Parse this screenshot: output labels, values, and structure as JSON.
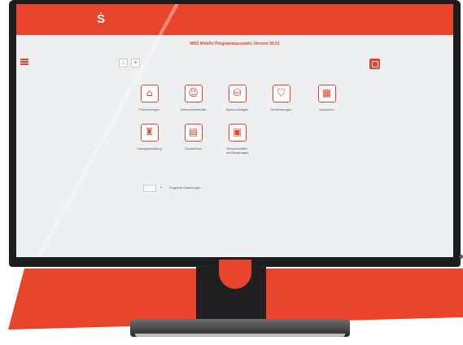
{
  "app": {
    "title": "MRZ-WebRx Programmauswahl, Version 00.01",
    "logo": "Ṡ",
    "brand_color": "#e8442b",
    "background_color": "#eeeff1"
  },
  "toolbar": {
    "menu_icon": "hamburger-icon",
    "home_icon": "home-icon",
    "list_icon": "list-icon",
    "home_glyph": "⌂",
    "list_glyph": "≡",
    "exit_icon": "exit-icon"
  },
  "tiles": [
    {
      "id": "finanzierungen",
      "label": "Finanzierungen",
      "icon": "house-icon",
      "glyph": "⌂"
    },
    {
      "id": "verbraucherkredite",
      "label": "Verbraucherkredite",
      "icon": "person-money-icon",
      "glyph": "☺"
    },
    {
      "id": "sparen-anlagen",
      "label": "Sparen-Anlagen",
      "icon": "coins-icon",
      "glyph": "⛁"
    },
    {
      "id": "versicherungen",
      "label": "Versicherungen",
      "icon": "shield-icon",
      "glyph": "⛉"
    },
    {
      "id": "bausparen",
      "label": "Bausparen",
      "icon": "bricks-icon",
      "glyph": "▦"
    },
    {
      "id": "vorsorgeberatung",
      "label": "Vorsorgeberatung",
      "icon": "armchair-icon",
      "glyph": "♜"
    },
    {
      "id": "sonderbuch",
      "label": "Sonderbuch",
      "icon": "calculator-icon",
      "glyph": "▤"
    },
    {
      "id": "personendaten",
      "label": "Personendaten\nund Beratungen",
      "icon": "save-icon",
      "glyph": "▣"
    }
  ],
  "options": {
    "checkbox_dot": "•",
    "checkbox_label": "Programm-Einstellungen"
  }
}
